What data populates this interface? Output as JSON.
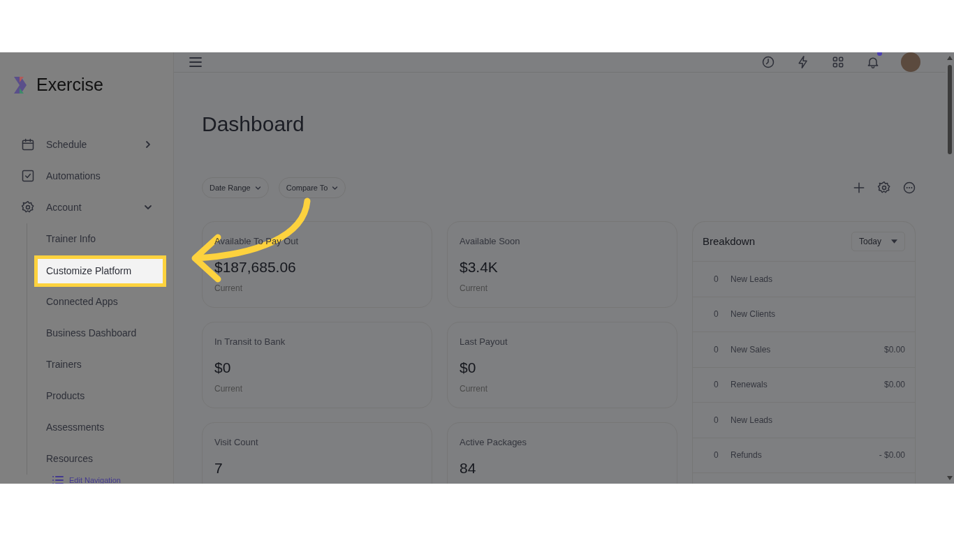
{
  "header": {
    "brand": "Exercise",
    "notification_dot": true
  },
  "sidebar": {
    "items": [
      {
        "label": "Schedule",
        "kind": "group",
        "expanded": false
      },
      {
        "label": "Automations",
        "kind": "link"
      },
      {
        "label": "Account",
        "kind": "group",
        "expanded": true,
        "children": [
          {
            "label": "Trainer Info",
            "selected": false
          },
          {
            "label": "Customize Platform",
            "selected": true
          },
          {
            "label": "Connected Apps",
            "selected": false
          },
          {
            "label": "Business Dashboard",
            "selected": false
          },
          {
            "label": "Trainers",
            "selected": false
          },
          {
            "label": "Products",
            "selected": false
          },
          {
            "label": "Assessments",
            "selected": false
          },
          {
            "label": "Resources",
            "selected": false
          }
        ]
      }
    ],
    "edit_navigation": "Edit Navigation"
  },
  "page_title": "Dashboard",
  "filters": [
    "Date Range",
    "Compare To"
  ],
  "cards": [
    {
      "label": "Available To Pay Out",
      "value": "$187,685.06",
      "caption": "Current"
    },
    {
      "label": "Available Soon",
      "value": "$3.4K",
      "caption": "Current"
    },
    {
      "label": "In Transit to Bank",
      "value": "$0",
      "caption": "Current"
    },
    {
      "label": "Last Payout",
      "value": "$0",
      "caption": "Current"
    },
    {
      "label": "Visit Count",
      "value": "7"
    },
    {
      "label": "Active Packages",
      "value": "84"
    }
  ],
  "breakdown": {
    "title": "Breakdown",
    "period": "Today",
    "rows": [
      {
        "count": "0",
        "label": "New Leads"
      },
      {
        "count": "0",
        "label": "New Clients"
      },
      {
        "count": "0",
        "label": "New Sales",
        "amount": "$0.00"
      },
      {
        "count": "0",
        "label": "Renewals",
        "amount": "$0.00"
      },
      {
        "count": "0",
        "label": "New Leads"
      },
      {
        "count": "0",
        "label": "Refunds",
        "amount": "- $0.00"
      }
    ]
  }
}
